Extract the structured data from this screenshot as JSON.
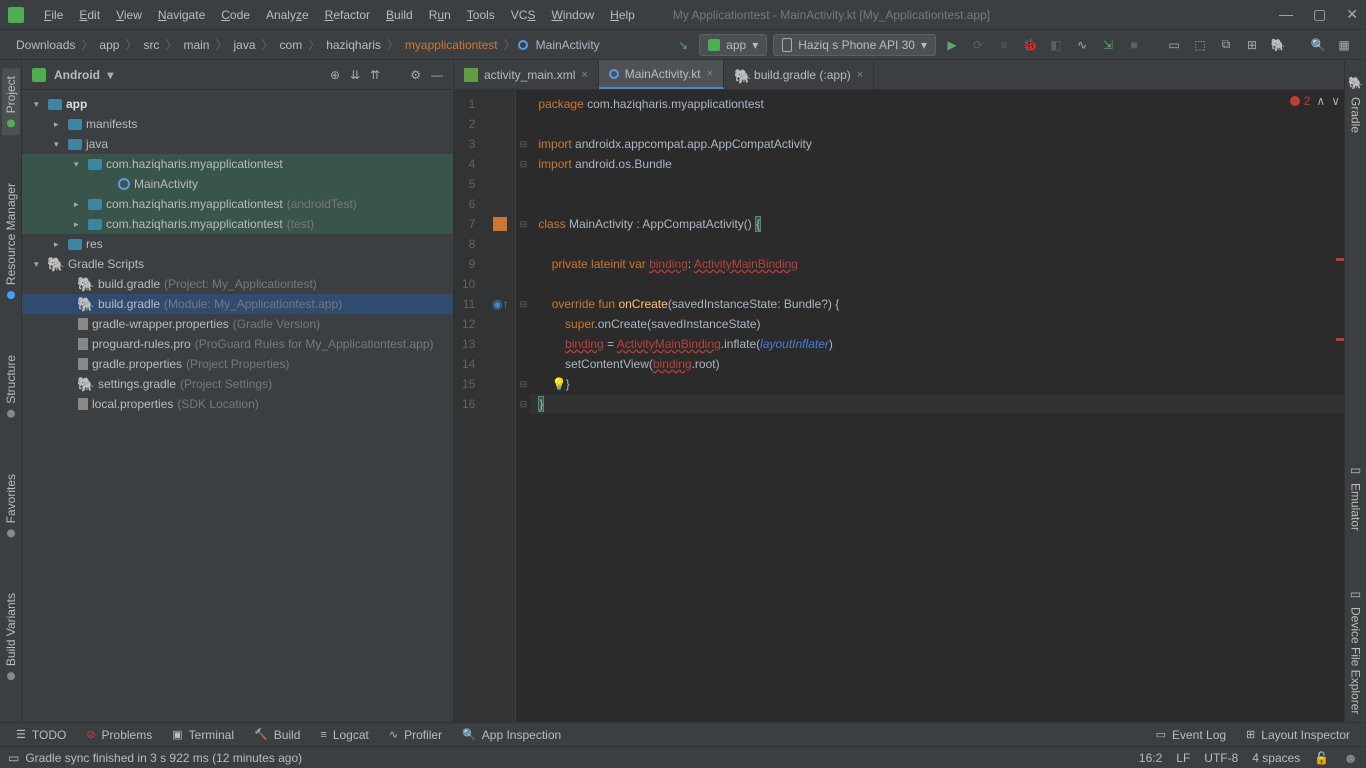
{
  "window": {
    "title": "My Applicationtest - MainActivity.kt [My_Applicationtest.app]"
  },
  "menu": [
    "File",
    "Edit",
    "View",
    "Navigate",
    "Code",
    "Analyze",
    "Refactor",
    "Build",
    "Run",
    "Tools",
    "VCS",
    "Window",
    "Help"
  ],
  "breadcrumbs": [
    "Downloads",
    "app",
    "src",
    "main",
    "java",
    "com",
    "haziqharis",
    "myapplicationtest",
    "MainActivity"
  ],
  "run_config": {
    "app": "app",
    "device": "Haziq s Phone API 30"
  },
  "project_panel": {
    "title": "Android"
  },
  "tree": {
    "app": "app",
    "manifests": "manifests",
    "java": "java",
    "pkg1": "com.haziqharis.myapplicationtest",
    "main_activity": "MainActivity",
    "pkg2": "com.haziqharis.myapplicationtest",
    "pkg2_hint": "(androidTest)",
    "pkg3": "com.haziqharis.myapplicationtest",
    "pkg3_hint": "(test)",
    "res": "res",
    "gradle_scripts": "Gradle Scripts",
    "bg1": "build.gradle",
    "bg1_hint": "(Project: My_Applicationtest)",
    "bg2": "build.gradle",
    "bg2_hint": "(Module: My_Applicationtest.app)",
    "gwp": "gradle-wrapper.properties",
    "gwp_hint": "(Gradle Version)",
    "pg": "proguard-rules.pro",
    "pg_hint": "(ProGuard Rules for My_Applicationtest.app)",
    "gp": "gradle.properties",
    "gp_hint": "(Project Properties)",
    "sg": "settings.gradle",
    "sg_hint": "(Project Settings)",
    "lp": "local.properties",
    "lp_hint": "(SDK Location)"
  },
  "left_tabs": [
    "Project",
    "Resource Manager",
    "Structure",
    "Favorites",
    "Build Variants"
  ],
  "right_tabs": [
    "Gradle",
    "Emulator",
    "Device File Explorer"
  ],
  "editor_tabs": [
    {
      "label": "activity_main.xml"
    },
    {
      "label": "MainActivity.kt"
    },
    {
      "label": "build.gradle (:app)"
    }
  ],
  "error_count": "2",
  "code": {
    "l1_kw": "package",
    "l1_pkg": "com.haziqharis.myapplicationtest",
    "l3_kw": "import",
    "l3_pkg": "androidx.appcompat.app.AppCompatActivity",
    "l4_kw": "import",
    "l4_pkg": "android.os.Bundle",
    "l7_kw": "class",
    "l7_name": "MainActivity : AppCompatActivity() ",
    "l9_mods": "private lateinit var ",
    "l9_bind": "binding",
    "l9_colon": ": ",
    "l9_type": "ActivityMainBinding",
    "l11_kw": "override",
    "l11_fun": "fun",
    "l11_name": "onCreate",
    "l11_sig": "(savedInstanceState: Bundle?) {",
    "l12_super": "super",
    "l12_call": ".onCreate(savedInstanceState)",
    "l13_bind": "binding",
    "l13_eq": " = ",
    "l13_type": "ActivityMainBinding",
    "l13_call": ".inflate(",
    "l13_param": "layoutInflater",
    "l13_end": ")",
    "l14_call": "setContentView(",
    "l14_bind": "binding",
    "l14_end": ".root)"
  },
  "bottom_tabs": {
    "todo": "TODO",
    "problems": "Problems",
    "terminal": "Terminal",
    "build": "Build",
    "logcat": "Logcat",
    "profiler": "Profiler",
    "inspect": "App Inspection",
    "event_log": "Event Log",
    "layout_inspector": "Layout Inspector"
  },
  "status": {
    "msg": "Gradle sync finished in 3 s 922 ms (12 minutes ago)",
    "pos": "16:2",
    "lf": "LF",
    "enc": "UTF-8",
    "indent": "4 spaces"
  }
}
